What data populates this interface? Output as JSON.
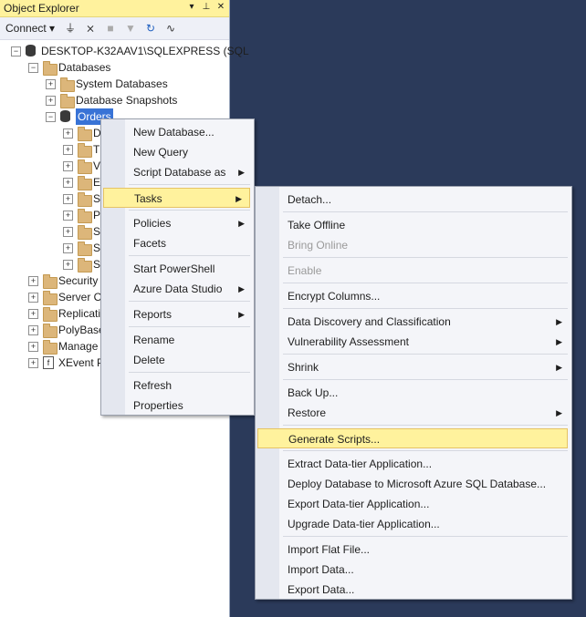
{
  "panel": {
    "title": "Object Explorer",
    "title_buttons": [
      "▾",
      "⊥",
      "✕"
    ],
    "toolbar": {
      "connect_label": "Connect ▾"
    }
  },
  "tree": [
    {
      "label": "DESKTOP-K32AAV1\\SQLEXPRESS (SQL",
      "level": 0,
      "expander": "−",
      "icon": "server-icon"
    },
    {
      "label": "Databases",
      "level": 1,
      "expander": "−",
      "icon": "folder-icon"
    },
    {
      "label": "System Databases",
      "level": 2,
      "expander": "+",
      "icon": "folder-icon"
    },
    {
      "label": "Database Snapshots",
      "level": 2,
      "expander": "+",
      "icon": "folder-icon"
    },
    {
      "label": "Orders",
      "level": 2,
      "expander": "−",
      "icon": "database-icon",
      "selected": true
    },
    {
      "label": "D",
      "level": 3,
      "expander": "+",
      "icon": "folder-icon"
    },
    {
      "label": "T",
      "level": 3,
      "expander": "+",
      "icon": "folder-icon"
    },
    {
      "label": "V",
      "level": 3,
      "expander": "+",
      "icon": "folder-icon"
    },
    {
      "label": "E",
      "level": 3,
      "expander": "+",
      "icon": "folder-icon"
    },
    {
      "label": "S",
      "level": 3,
      "expander": "+",
      "icon": "folder-icon"
    },
    {
      "label": "P",
      "level": 3,
      "expander": "+",
      "icon": "folder-icon"
    },
    {
      "label": "S",
      "level": 3,
      "expander": "+",
      "icon": "folder-icon"
    },
    {
      "label": "S",
      "level": 3,
      "expander": "+",
      "icon": "folder-icon"
    },
    {
      "label": "S",
      "level": 3,
      "expander": "+",
      "icon": "folder-icon"
    },
    {
      "label": "Security",
      "level": 1,
      "expander": "+",
      "icon": "folder-icon"
    },
    {
      "label": "Server O",
      "level": 1,
      "expander": "+",
      "icon": "folder-icon"
    },
    {
      "label": "Replicati",
      "level": 1,
      "expander": "+",
      "icon": "folder-icon"
    },
    {
      "label": "PolyBase",
      "level": 1,
      "expander": "+",
      "icon": "folder-icon"
    },
    {
      "label": "Manage",
      "level": 1,
      "expander": "+",
      "icon": "folder-icon"
    },
    {
      "label": "XEvent P",
      "level": 1,
      "expander": "+",
      "icon": "xevent-icon"
    }
  ],
  "context_menu": [
    {
      "label": "New Database...",
      "submenu": false
    },
    {
      "label": "New Query",
      "submenu": false
    },
    {
      "label": "Script Database as",
      "submenu": true
    },
    {
      "sep": true
    },
    {
      "label": "Tasks",
      "submenu": true,
      "highlighted": true
    },
    {
      "sep": true
    },
    {
      "label": "Policies",
      "submenu": true
    },
    {
      "label": "Facets",
      "submenu": false
    },
    {
      "sep": true
    },
    {
      "label": "Start PowerShell",
      "submenu": false
    },
    {
      "label": "Azure Data Studio",
      "submenu": true
    },
    {
      "sep": true
    },
    {
      "label": "Reports",
      "submenu": true
    },
    {
      "sep": true
    },
    {
      "label": "Rename",
      "submenu": false
    },
    {
      "label": "Delete",
      "submenu": false
    },
    {
      "sep": true
    },
    {
      "label": "Refresh",
      "submenu": false
    },
    {
      "label": "Properties",
      "submenu": false
    }
  ],
  "tasks_menu": [
    {
      "label": "Detach...",
      "submenu": false
    },
    {
      "sep": true
    },
    {
      "label": "Take Offline",
      "submenu": false
    },
    {
      "label": "Bring Online",
      "submenu": false,
      "disabled": true
    },
    {
      "sep": true
    },
    {
      "label": "Enable",
      "submenu": false,
      "disabled": true
    },
    {
      "sep": true
    },
    {
      "label": "Encrypt Columns...",
      "submenu": false
    },
    {
      "sep": true
    },
    {
      "label": "Data Discovery and Classification",
      "submenu": true
    },
    {
      "label": "Vulnerability Assessment",
      "submenu": true
    },
    {
      "sep": true
    },
    {
      "label": "Shrink",
      "submenu": true
    },
    {
      "sep": true
    },
    {
      "label": "Back Up...",
      "submenu": false
    },
    {
      "label": "Restore",
      "submenu": true
    },
    {
      "sep": true
    },
    {
      "label": "Generate Scripts...",
      "submenu": false,
      "highlighted": true
    },
    {
      "sep": true
    },
    {
      "label": "Extract Data-tier Application...",
      "submenu": false
    },
    {
      "label": "Deploy Database to Microsoft Azure SQL Database...",
      "submenu": false
    },
    {
      "label": "Export Data-tier Application...",
      "submenu": false
    },
    {
      "label": "Upgrade Data-tier Application...",
      "submenu": false
    },
    {
      "sep": true
    },
    {
      "label": "Import Flat File...",
      "submenu": false
    },
    {
      "label": "Import Data...",
      "submenu": false
    },
    {
      "label": "Export Data...",
      "submenu": false
    }
  ]
}
